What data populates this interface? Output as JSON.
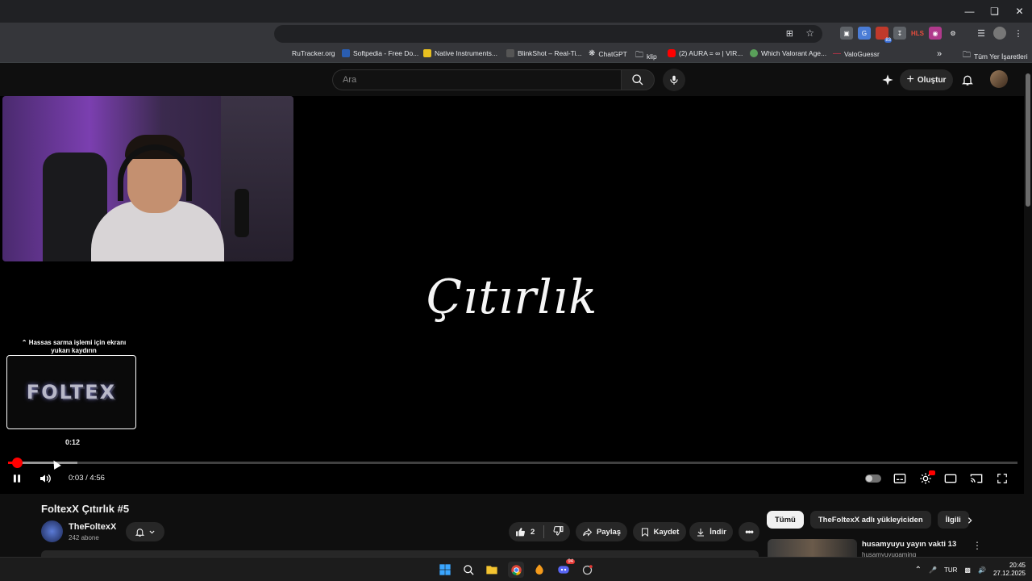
{
  "browser": {
    "bookmarks": [
      {
        "label": "RuTracker.org",
        "color": "#3b6fb6"
      },
      {
        "label": "Softpedia - Free Do...",
        "color": "#2a5db0"
      },
      {
        "label": "Native Instruments...",
        "color": "#e8c020"
      },
      {
        "label": "BlinkShot – Real-Ti...",
        "color": "#555555"
      },
      {
        "label": "ChatGPT",
        "color": "#ffffff"
      },
      {
        "label": "klip",
        "color": "#888888"
      },
      {
        "label": "(2) AURA = ∞ | VIR...",
        "color": "#ff0000"
      },
      {
        "label": "Which Valorant Age...",
        "color": "#5aa05a"
      },
      {
        "label": "ValoGuessr",
        "color": "#e0304a"
      }
    ],
    "bookmarks_more": "»",
    "all_bookmarks": "Tüm Yer İşaretleri",
    "badge_count": "83"
  },
  "header": {
    "search_placeholder": "Ara",
    "create_label": "Oluştur"
  },
  "video": {
    "overlay_title": "Çıtırlık",
    "webcam_label": "Webcam overlay",
    "scrub_hint": "⌃ Hassas sarma işlemi için ekranı yukarı kaydırın",
    "preview_logo": "FOLTEX",
    "preview_time": "0:12",
    "time_display": "0:03 / 4:56",
    "played_fraction": 0.009,
    "buffered_fraction": 0.069,
    "hover_fraction": 0.043
  },
  "details": {
    "title": "FoltexX Çıtırlık #5",
    "channel_name": "TheFoltexX",
    "subscribers": "242 abone",
    "like_count": "2",
    "share_label": "Paylaş",
    "save_label": "Kaydet",
    "download_label": "İndir"
  },
  "sidebar": {
    "chips": [
      "Tümü",
      "TheFoltexX adlı yükleyiciden",
      "İlgili"
    ],
    "rec_title": "husamyuyu yayın vakti 13",
    "rec_channel": "husamyuyugaming"
  },
  "taskbar": {
    "lang": "TUR",
    "time": "20:45",
    "date": "27.12.2025",
    "discord_badge": "94"
  },
  "colors": {
    "accent": "#ff0000",
    "background": "#0f0f0f"
  }
}
